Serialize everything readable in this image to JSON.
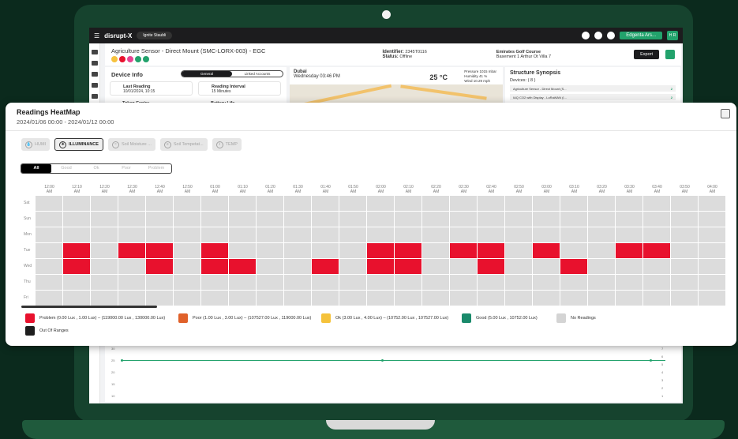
{
  "app": {
    "logo": "disrupt-X",
    "user_select": "Ignite Staubli",
    "org_button": "Edgenta Ars...",
    "avatar": "H R"
  },
  "device": {
    "title": "Agriculture Sensor - Direct Mount (SMC-LORX-003) - EGC",
    "identifier_label": "Identifier:",
    "identifier_value": "2345T0116",
    "status_label": "Status:",
    "status_value": "Offline",
    "location_name": "Emirates Golf Course",
    "location_sub": "Basement 1 Arthur Ot Villa 7",
    "export_label": "Export"
  },
  "device_info": {
    "title": "Device Info",
    "tabs": [
      "General",
      "Linked Accounts"
    ],
    "last_reading_label": "Last Reading",
    "last_reading_value": "10/01/2024, 10:15",
    "reading_interval_label": "Reading Interval",
    "reading_interval_value": "15 Minutes",
    "token_expiry_label": "Token Expiry",
    "battery_life_label": "Battery Life"
  },
  "weather": {
    "city": "Dubai",
    "datetime": "Wednesday 03:46 PM",
    "temperature": "25 °C",
    "pressure": "Pressure 1015 mbar",
    "humidity": "Humidity    41 %",
    "wind": "Wind    10.29 mph"
  },
  "structure": {
    "title": "Structure Synopsis",
    "devices_label": "Devices: ( 8 )",
    "rows": [
      {
        "label": "Agriculture Sensor - Direct Mount (S...",
        "count": "2"
      },
      {
        "label": "IAQ CO2 with Display - LoRaWAN (I...",
        "count": "2"
      }
    ]
  },
  "heatmap": {
    "title": "Readings HeatMap",
    "date_range": "2024/01/06 00:00 - 2024/01/12 00:00",
    "sensor_tabs": [
      "HUMI",
      "ILLUMINANCE",
      "Soil Moisture ...",
      "Soil Tempetat...",
      "TEMP"
    ],
    "active_sensor": "ILLUMINANCE",
    "status_filters": [
      "All",
      "Good",
      "Ok",
      "Poor",
      "Problem"
    ],
    "active_status": "All",
    "time_labels": [
      "12:00 AM",
      "12:10 AM",
      "12:20 AM",
      "12:30 AM",
      "12:40 AM",
      "12:50 AM",
      "01:00 AM",
      "01:10 AM",
      "01:20 AM",
      "01:30 AM",
      "01:40 AM",
      "01:50 AM",
      "02:00 AM",
      "02:10 AM",
      "02:20 AM",
      "02:30 AM",
      "02:40 AM",
      "02:50 AM",
      "03:00 AM",
      "03:10 AM",
      "03:20 AM",
      "03:30 AM",
      "03:40 AM",
      "03:50 AM",
      "04:00 AM"
    ],
    "days": [
      "Sat",
      "Sun",
      "Mon",
      "Tue",
      "Wed",
      "Thu",
      "Fri"
    ],
    "problem_cells": {
      "Tue": [
        1,
        3,
        4,
        6,
        12,
        13,
        15,
        16,
        18,
        21,
        22
      ],
      "Wed": [
        1,
        4,
        6,
        7,
        10,
        12,
        13,
        16,
        19
      ]
    },
    "legend": [
      {
        "label": "Problem (0.00 Lux , 1.00 Lux) – (119000.00 Lux , 130000.00 Lux)",
        "color": "#e8112d"
      },
      {
        "label": "Poor (1.00 Lux , 3.00 Lux) – (107527.00 Lux , 119000.00 Lux)",
        "color": "#e0612a"
      },
      {
        "label": "Ok (3.00 Lux , 4.00 Lux) – (10752.00 Lux , 107527.00 Lux)",
        "color": "#f5c23b"
      },
      {
        "label": "Good (5.00 Lux , 10752.00 Lux)",
        "color": "#1a8a6b"
      },
      {
        "label": "No Readings",
        "color": "#d4d4d4"
      },
      {
        "label": "Out Of Ranges",
        "color": "#1e1e1e"
      }
    ],
    "colors": {
      "problem": "#e8112d",
      "empty": "#dcdcdc"
    }
  },
  "bottom_chart": {
    "y_ticks": [
      "30",
      "25",
      "20",
      "15",
      "10"
    ],
    "y2_ticks": [
      "7",
      "6",
      "5",
      "4",
      "3",
      "2",
      "1"
    ]
  }
}
